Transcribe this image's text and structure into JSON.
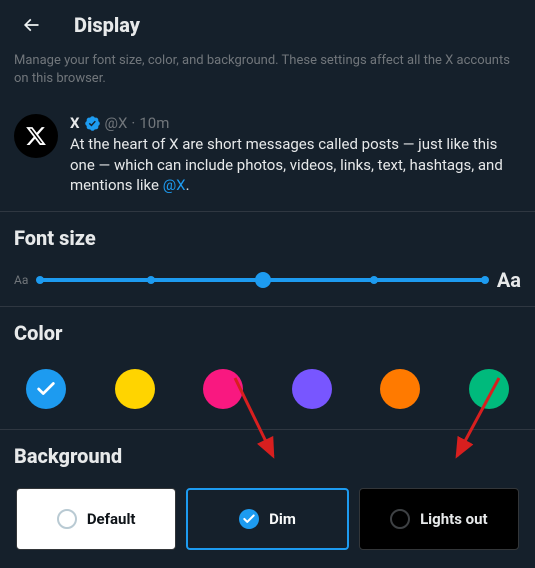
{
  "header": {
    "title": "Display"
  },
  "description": "Manage your font size, color, and background. These settings affect all the X accounts on this browser.",
  "sample_post": {
    "name": "X",
    "handle": "@X",
    "separator": "·",
    "time": "10m",
    "body_part1": "At the heart of X are short messages called posts — just like this one — which can include photos, videos, links, text, hashtags, and mentions like ",
    "body_mention": "@X",
    "body_part2": "."
  },
  "sections": {
    "font_size": {
      "title": "Font size",
      "small_label": "Aa",
      "large_label": "Aa"
    },
    "color": {
      "title": "Color",
      "options": [
        {
          "name": "blue",
          "hex": "#1d9bf0",
          "selected": true
        },
        {
          "name": "yellow",
          "hex": "#ffd400",
          "selected": false
        },
        {
          "name": "pink",
          "hex": "#f91880",
          "selected": false
        },
        {
          "name": "purple",
          "hex": "#7856ff",
          "selected": false
        },
        {
          "name": "orange",
          "hex": "#ff7a00",
          "selected": false
        },
        {
          "name": "green",
          "hex": "#00ba7c",
          "selected": false
        }
      ]
    },
    "background": {
      "title": "Background",
      "options": {
        "default": "Default",
        "dim": "Dim",
        "lightsout": "Lights out"
      },
      "selected": "dim"
    }
  }
}
